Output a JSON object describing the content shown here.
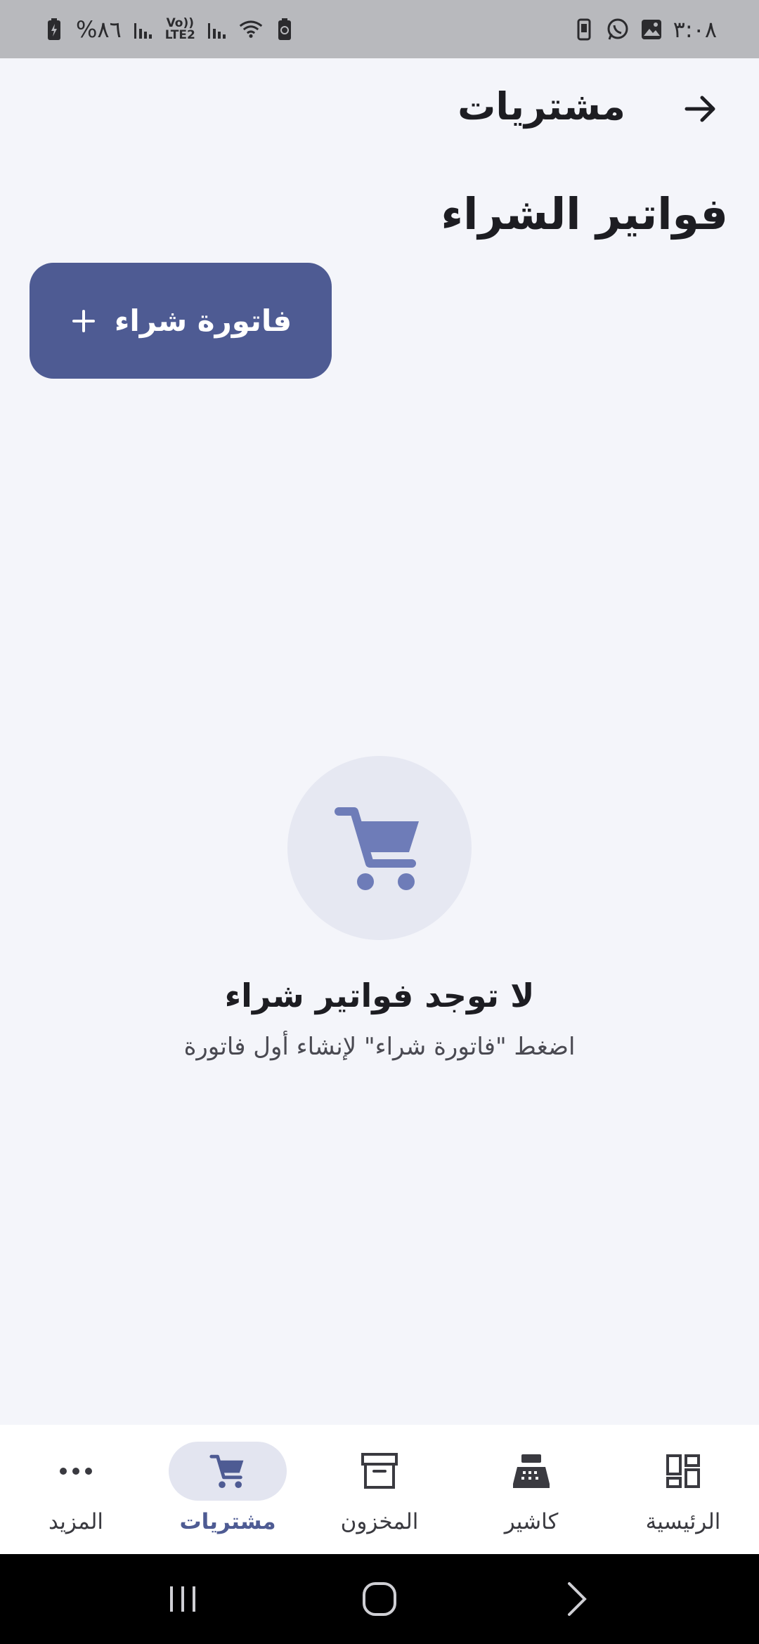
{
  "status_bar": {
    "time": "٣:٠٨",
    "battery": "%٨٦",
    "network_label_top": "Vo))",
    "network_label_bottom": "LTE2"
  },
  "header": {
    "title": "مشتريات",
    "back_icon": "arrow-right-icon"
  },
  "page": {
    "section_title": "فواتير الشراء",
    "new_button_label": "فاتورة شراء",
    "new_button_icon": "plus-icon"
  },
  "empty_state": {
    "icon": "cart-icon",
    "title": "لا توجد فواتير شراء",
    "subtitle": "اضغط \"فاتورة شراء\" لإنشاء أول فاتورة"
  },
  "bottom_nav": {
    "items": [
      {
        "label": "الرئيسية",
        "icon": "dashboard-icon",
        "active": false
      },
      {
        "label": "كاشير",
        "icon": "cash-register-icon",
        "active": false
      },
      {
        "label": "المخزون",
        "icon": "archive-box-icon",
        "active": false
      },
      {
        "label": "مشتريات",
        "icon": "cart-icon",
        "active": true
      },
      {
        "label": "المزيد",
        "icon": "more-dots-icon",
        "active": false
      }
    ]
  },
  "colors": {
    "accent": "#4e5b93",
    "background": "#f4f5fa",
    "cart_icon": "#6e7cb8"
  }
}
